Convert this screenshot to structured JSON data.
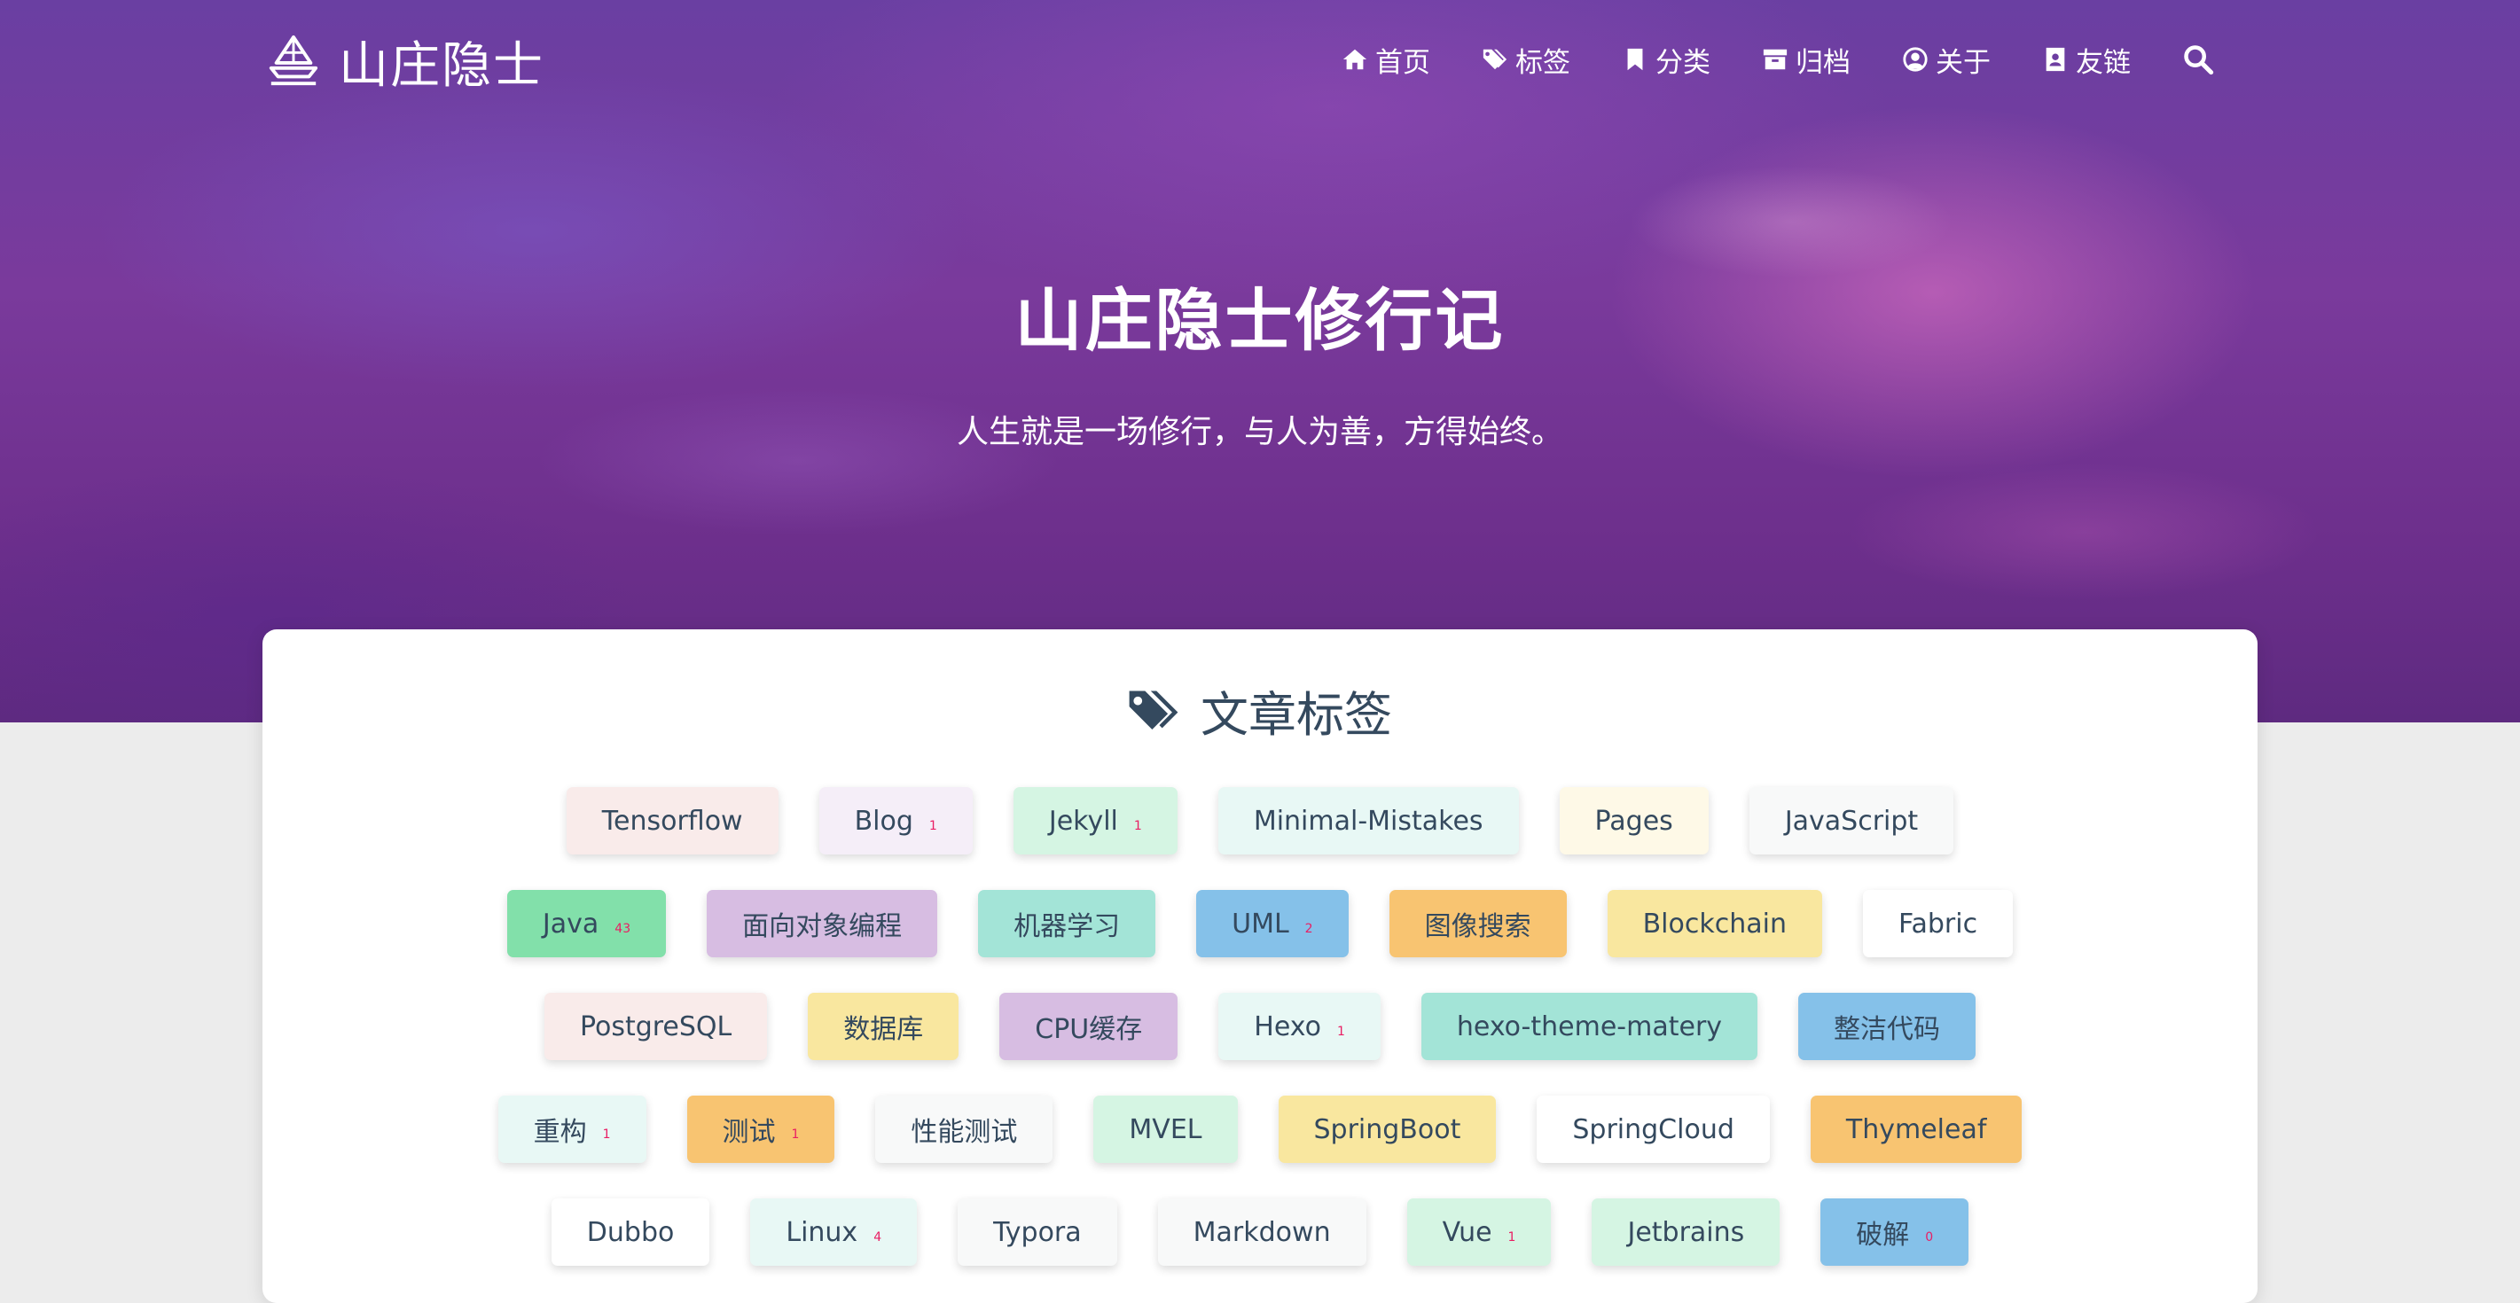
{
  "brand": {
    "name": "山庄隐士"
  },
  "nav": {
    "items": [
      {
        "label": "首页",
        "icon": "home-icon"
      },
      {
        "label": "标签",
        "icon": "tags-icon"
      },
      {
        "label": "分类",
        "icon": "bookmark-icon"
      },
      {
        "label": "归档",
        "icon": "archive-icon"
      },
      {
        "label": "关于",
        "icon": "user-circle-icon"
      },
      {
        "label": "友链",
        "icon": "address-book-icon"
      }
    ],
    "search_icon": "search-icon"
  },
  "hero": {
    "title": "山庄隐士修行记",
    "subtitle": "人生就是一场修行，与人为善，方得始终。"
  },
  "tags_section": {
    "title": "文章标签",
    "icon": "tags-icon",
    "count_color": "#e91e63",
    "rows": [
      [
        {
          "name": "Tensorflow",
          "count": "",
          "color": "#f9ebea"
        },
        {
          "name": "Blog",
          "count": "1",
          "color": "#f5eef8"
        },
        {
          "name": "Jekyll",
          "count": "1",
          "color": "#d5f5e3"
        },
        {
          "name": "Minimal-Mistakes",
          "count": "",
          "color": "#e8f8f5"
        },
        {
          "name": "Pages",
          "count": "",
          "color": "#fef9e7"
        },
        {
          "name": "JavaScript",
          "count": "",
          "color": "#f8f9f9"
        }
      ],
      [
        {
          "name": "Java",
          "count": "43",
          "color": "#82e0aa"
        },
        {
          "name": "面向对象编程",
          "count": "",
          "color": "#d7bde2"
        },
        {
          "name": "机器学习",
          "count": "",
          "color": "#a3e4d7"
        },
        {
          "name": "UML",
          "count": "2",
          "color": "#85c1e9"
        },
        {
          "name": "图像搜索",
          "count": "",
          "color": "#f8c471"
        },
        {
          "name": "Blockchain",
          "count": "",
          "color": "#f9e79f"
        },
        {
          "name": "Fabric",
          "count": "",
          "color": "#ffffff"
        }
      ],
      [
        {
          "name": "PostgreSQL",
          "count": "",
          "color": "#f9ebea"
        },
        {
          "name": "数据库",
          "count": "",
          "color": "#f9e79f"
        },
        {
          "name": "CPU缓存",
          "count": "",
          "color": "#d7bde2"
        },
        {
          "name": "Hexo",
          "count": "1",
          "color": "#e8f8f5"
        },
        {
          "name": "hexo-theme-matery",
          "count": "",
          "color": "#a3e4d7"
        },
        {
          "name": "整洁代码",
          "count": "",
          "color": "#85c1e9"
        }
      ],
      [
        {
          "name": "重构",
          "count": "1",
          "color": "#e8f8f5"
        },
        {
          "name": "测试",
          "count": "1",
          "color": "#f8c471"
        },
        {
          "name": "性能测试",
          "count": "",
          "color": "#f8f9f9"
        },
        {
          "name": "MVEL",
          "count": "",
          "color": "#d5f5e3"
        },
        {
          "name": "SpringBoot",
          "count": "",
          "color": "#f9e79f"
        },
        {
          "name": "SpringCloud",
          "count": "",
          "color": "#ffffff"
        },
        {
          "name": "Thymeleaf",
          "count": "",
          "color": "#f8c471"
        }
      ],
      [
        {
          "name": "Dubbo",
          "count": "",
          "color": "#ffffff"
        },
        {
          "name": "Linux",
          "count": "4",
          "color": "#e8f8f5"
        },
        {
          "name": "Typora",
          "count": "",
          "color": "#f8f9f9"
        },
        {
          "name": "Markdown",
          "count": "",
          "color": "#f8f9f9"
        },
        {
          "name": "Vue",
          "count": "1",
          "color": "#d5f5e3"
        },
        {
          "name": "Jetbrains",
          "count": "",
          "color": "#d5f5e3"
        },
        {
          "name": "破解",
          "count": "0",
          "color": "#85c1e9"
        }
      ]
    ]
  }
}
